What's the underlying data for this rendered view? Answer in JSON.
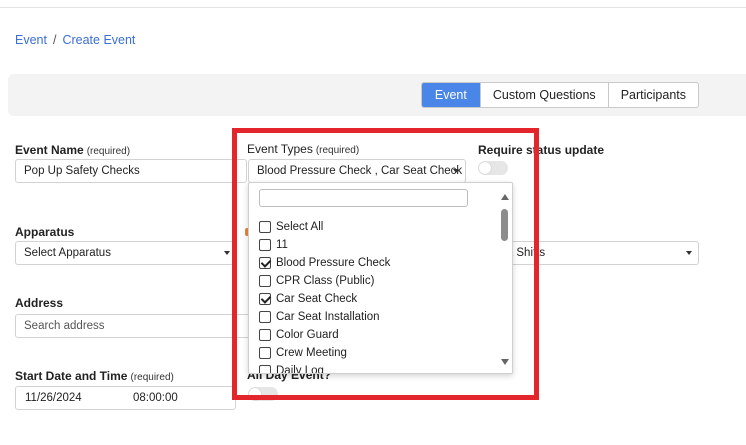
{
  "breadcrumb": {
    "parent": "Event",
    "separator": "/",
    "current": "Create Event"
  },
  "tabs": [
    {
      "label": "Event",
      "active": true
    },
    {
      "label": "Custom Questions",
      "active": false
    },
    {
      "label": "Participants",
      "active": false
    }
  ],
  "form": {
    "event_name": {
      "label": "Event Name",
      "required": "(required)",
      "value": "Pop Up Safety Checks"
    },
    "event_types": {
      "label": "Event Types",
      "required": "(required)",
      "value": "Blood Pressure Check , Car Seat Check"
    },
    "require_status": {
      "label": "Require status update",
      "on": false
    },
    "apparatus": {
      "label": "Apparatus",
      "value": "Select Apparatus"
    },
    "shifts": {
      "value": "t Shifts"
    },
    "address": {
      "label": "Address",
      "placeholder": "Search address"
    },
    "start": {
      "label": "Start Date and Time",
      "required": "(required)",
      "date": "11/26/2024",
      "time": "08:00:00"
    },
    "all_day": {
      "label": "All Day Event?",
      "on": false
    }
  },
  "dropdown": {
    "search_value": "",
    "items": [
      {
        "label": "Select All",
        "checked": false
      },
      {
        "label": "11",
        "checked": false
      },
      {
        "label": "Blood Pressure Check",
        "checked": true
      },
      {
        "label": "CPR Class (Public)",
        "checked": false
      },
      {
        "label": "Car Seat Check",
        "checked": true
      },
      {
        "label": "Car Seat Installation",
        "checked": false
      },
      {
        "label": "Color Guard",
        "checked": false
      },
      {
        "label": "Crew Meeting",
        "checked": false
      },
      {
        "label": "Daily Log",
        "checked": false
      }
    ]
  },
  "colors": {
    "accent": "#4a86e8",
    "highlight": "#e3262b",
    "link": "#3b6fd1"
  }
}
